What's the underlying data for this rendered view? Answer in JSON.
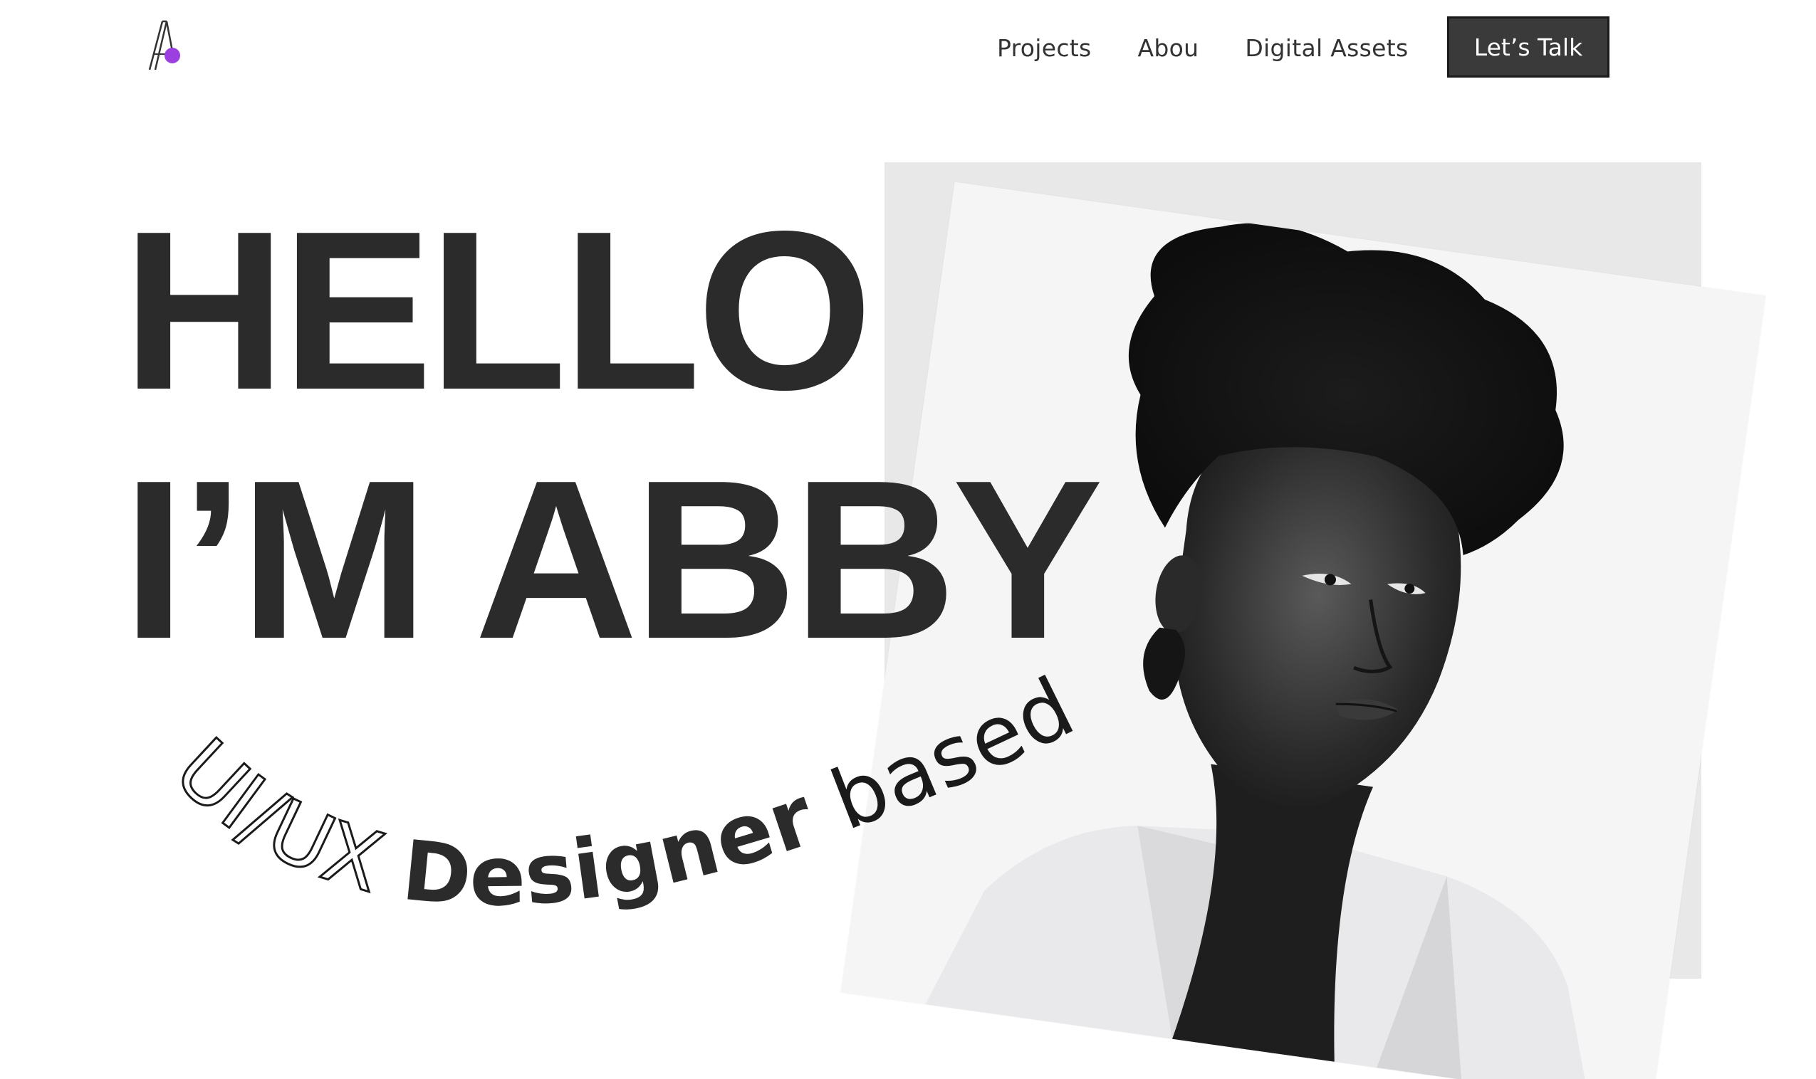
{
  "header": {
    "logo_icon": "a-monogram-logo-icon",
    "accent_color": "#9b3fe0",
    "nav": [
      {
        "label": "Projects"
      },
      {
        "label": "Abou"
      },
      {
        "label": "Digital Assets"
      }
    ],
    "cta_label": "Let’s Talk"
  },
  "hero": {
    "headline_line1": "HELLO",
    "headline_line2": "I’M ABBY",
    "tagline": {
      "part_outline": "UI/UX",
      "part_bold": "Designer",
      "part_regular": "based in UK"
    },
    "portrait_icon": "portrait-photo"
  },
  "colors": {
    "text": "#2b2b2b",
    "cta_bg": "#3a3a3a",
    "backdrop": "#e8e8e8"
  }
}
